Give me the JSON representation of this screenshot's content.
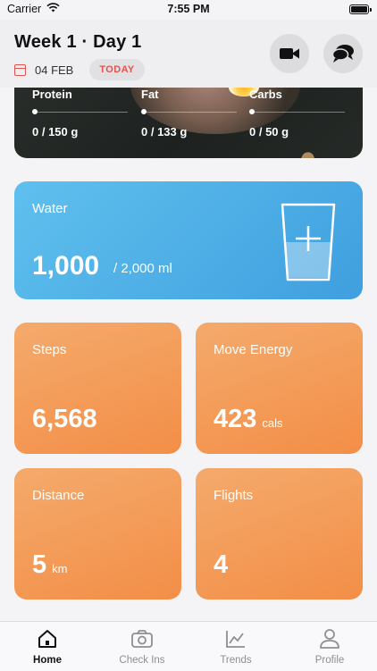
{
  "status_bar": {
    "carrier": "Carrier",
    "time": "7:55 PM"
  },
  "header": {
    "title": "Week 1 · Day 1",
    "date": "04 FEB",
    "today_label": "TODAY"
  },
  "macros": [
    {
      "name": "Protein",
      "value": "0 / 150 g"
    },
    {
      "name": "Fat",
      "value": "0 / 133 g"
    },
    {
      "name": "Carbs",
      "value": "0 / 50 g"
    }
  ],
  "water": {
    "label": "Water",
    "amount": "1,000",
    "target": "/  2,000 ml"
  },
  "stats": {
    "steps": {
      "label": "Steps",
      "value": "6,568",
      "unit": ""
    },
    "move_energy": {
      "label": "Move Energy",
      "value": "423",
      "unit": "cals"
    },
    "distance": {
      "label": "Distance",
      "value": "5",
      "unit": "km"
    },
    "flights": {
      "label": "Flights",
      "value": "4",
      "unit": ""
    }
  },
  "tabs": [
    {
      "label": "Home",
      "icon": "home-icon",
      "active": true
    },
    {
      "label": "Check Ins",
      "icon": "camera-icon",
      "active": false
    },
    {
      "label": "Trends",
      "icon": "chart-icon",
      "active": false
    },
    {
      "label": "Profile",
      "icon": "person-icon",
      "active": false
    }
  ],
  "colors": {
    "accent_red": "#e05353",
    "water_blue": "#4aa8e4",
    "stat_orange": "#f4a060"
  }
}
